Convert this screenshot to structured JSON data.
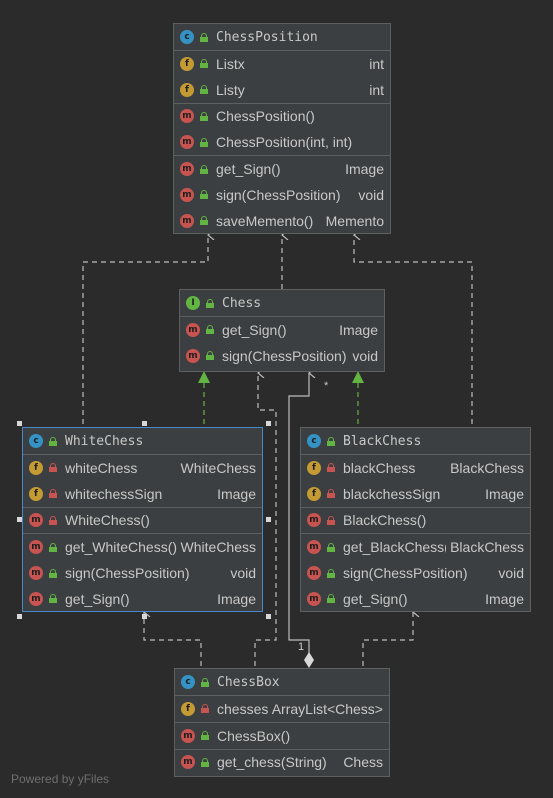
{
  "classes": {
    "chessposition": {
      "name": "ChessPosition",
      "fields": [
        {
          "name": "Listx",
          "type": "int"
        },
        {
          "name": "Listy",
          "type": "int"
        }
      ],
      "constructors": [
        {
          "name": "ChessPosition()",
          "type": ""
        },
        {
          "name": "ChessPosition(int, int)",
          "type": ""
        }
      ],
      "methods": [
        {
          "name": "get_Sign()",
          "type": "Image"
        },
        {
          "name": "sign(ChessPosition)",
          "type": "void"
        },
        {
          "name": "saveMemento()",
          "type": "Memento"
        }
      ]
    },
    "chess": {
      "name": "Chess",
      "methods": [
        {
          "name": "get_Sign()",
          "type": "Image"
        },
        {
          "name": "sign(ChessPosition)",
          "type": "void"
        }
      ]
    },
    "whitechess": {
      "name": "WhiteChess",
      "fields": [
        {
          "name": "whiteChess",
          "type": "WhiteChess"
        },
        {
          "name": "whitechessSign",
          "type": "Image"
        }
      ],
      "constructors": [
        {
          "name": "WhiteChess()",
          "type": ""
        }
      ],
      "methods": [
        {
          "name": "get_WhiteChess()",
          "type": "WhiteChess"
        },
        {
          "name": "sign(ChessPosition)",
          "type": "void"
        },
        {
          "name": "get_Sign()",
          "type": "Image"
        }
      ]
    },
    "blackchess": {
      "name": "BlackChess",
      "fields": [
        {
          "name": "blackChess",
          "type": "BlackChess"
        },
        {
          "name": "blackchessSign",
          "type": "Image"
        }
      ],
      "constructors": [
        {
          "name": "BlackChess()",
          "type": ""
        }
      ],
      "methods": [
        {
          "name": "get_BlackChess()",
          "type": "BlackChess"
        },
        {
          "name": "sign(ChessPosition)",
          "type": "void"
        },
        {
          "name": "get_Sign()",
          "type": "Image"
        }
      ]
    },
    "chessbox": {
      "name": "ChessBox",
      "fields": [
        {
          "name": "chesses",
          "type": "ArrayList<Chess>"
        }
      ],
      "constructors": [
        {
          "name": "ChessBox()",
          "type": ""
        }
      ],
      "methods": [
        {
          "name": "get_chess(String)",
          "type": "Chess"
        }
      ]
    }
  },
  "icons": {
    "class_letter": "c",
    "interface_letter": "I",
    "field_letter": "f",
    "method_letter": "m"
  },
  "multiplicity": {
    "source": "1",
    "target": "*"
  },
  "footer": "Powered by yFiles",
  "colors": {
    "background": "#2b2b2b",
    "node": "#3c3f41",
    "border": "#5e6060",
    "selection": "#4a88c7",
    "realization": "#62b543",
    "edge": "#bcbcbc"
  }
}
